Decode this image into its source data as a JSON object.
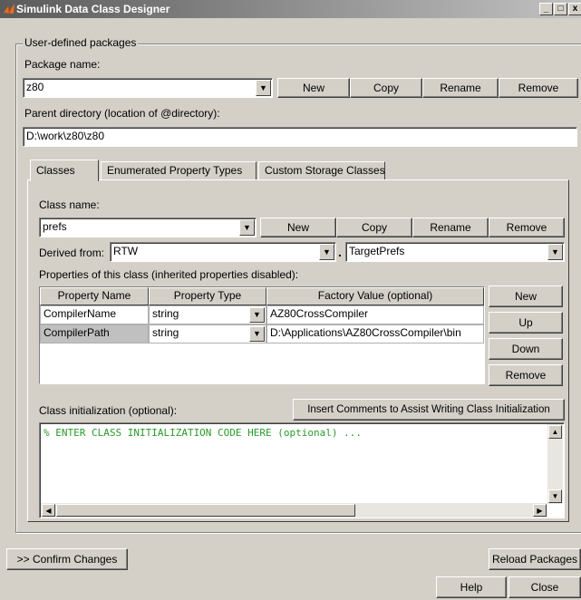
{
  "window": {
    "title": "Simulink Data Class Designer",
    "minimize": "_",
    "maximize": "□",
    "close": "x"
  },
  "packages": {
    "group_label": "User-defined packages",
    "package_name_label": "Package name:",
    "package_name_value": "z80",
    "buttons": {
      "new": "New",
      "copy": "Copy",
      "rename": "Rename",
      "remove": "Remove"
    },
    "parent_dir_label": "Parent directory (location of @directory):",
    "parent_dir_value": "D:\\work\\z80\\z80"
  },
  "tabs": [
    {
      "label": "Classes",
      "active": true
    },
    {
      "label": "Enumerated Property Types",
      "active": false
    },
    {
      "label": "Custom Storage Classes",
      "active": false
    }
  ],
  "classes": {
    "class_name_label": "Class name:",
    "class_name_value": "prefs",
    "buttons": {
      "new": "New",
      "copy": "Copy",
      "rename": "Rename",
      "remove": "Remove"
    },
    "derived_from_label": "Derived from:",
    "derived_pkg": "RTW",
    "derived_sep": ".",
    "derived_class": "TargetPrefs",
    "properties_label": "Properties of this class (inherited properties disabled):",
    "table": {
      "headers": [
        "Property Name",
        "Property Type",
        "Factory Value (optional)"
      ],
      "rows": [
        {
          "name": "CompilerName",
          "type": "string",
          "value": "AZ80CrossCompiler"
        },
        {
          "name": "CompilerPath",
          "type": "string",
          "value": "D:\\Applications\\AZ80CrossCompiler\\bin"
        }
      ]
    },
    "prop_buttons": {
      "new": "New",
      "up": "Up",
      "down": "Down",
      "remove": "Remove"
    },
    "init_label": "Class initialization (optional):",
    "insert_comments_button": "Insert Comments to Assist Writing Class Initialization",
    "init_code": "% ENTER CLASS INITIALIZATION CODE HERE (optional) ..."
  },
  "footer": {
    "confirm": ">> Confirm Changes",
    "reload": "Reload Packages",
    "help": "Help",
    "close": "Close"
  },
  "colors": {
    "title_gradient_start": "#5a5a5a",
    "code_text": "#2a9a2a",
    "face": "#d4d0c8"
  }
}
